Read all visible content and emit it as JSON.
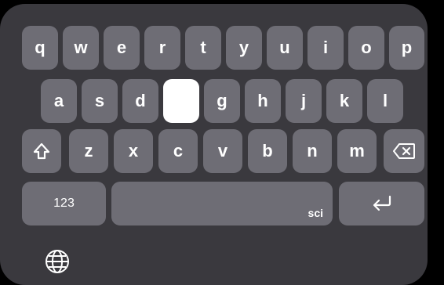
{
  "keyboard": {
    "row1": [
      "q",
      "w",
      "e",
      "r",
      "t",
      "y",
      "u",
      "i",
      "o",
      "p"
    ],
    "row2": [
      "a",
      "s",
      "d",
      "",
      "g",
      "h",
      "j",
      "k",
      "l"
    ],
    "row3": [
      "z",
      "x",
      "c",
      "v",
      "b",
      "n",
      "m"
    ],
    "shift_icon": "shift-icon",
    "backspace_icon": "backspace-icon",
    "numbers_label": "123",
    "space_hint": "sci",
    "return_icon": "return-icon",
    "globe_icon": "globe-icon",
    "pressed_key_index_row2": 3,
    "colors": {
      "background": "#3a393e",
      "key": "#6e6d75",
      "key_pressed": "#ffffff",
      "label": "#ffffff"
    }
  }
}
